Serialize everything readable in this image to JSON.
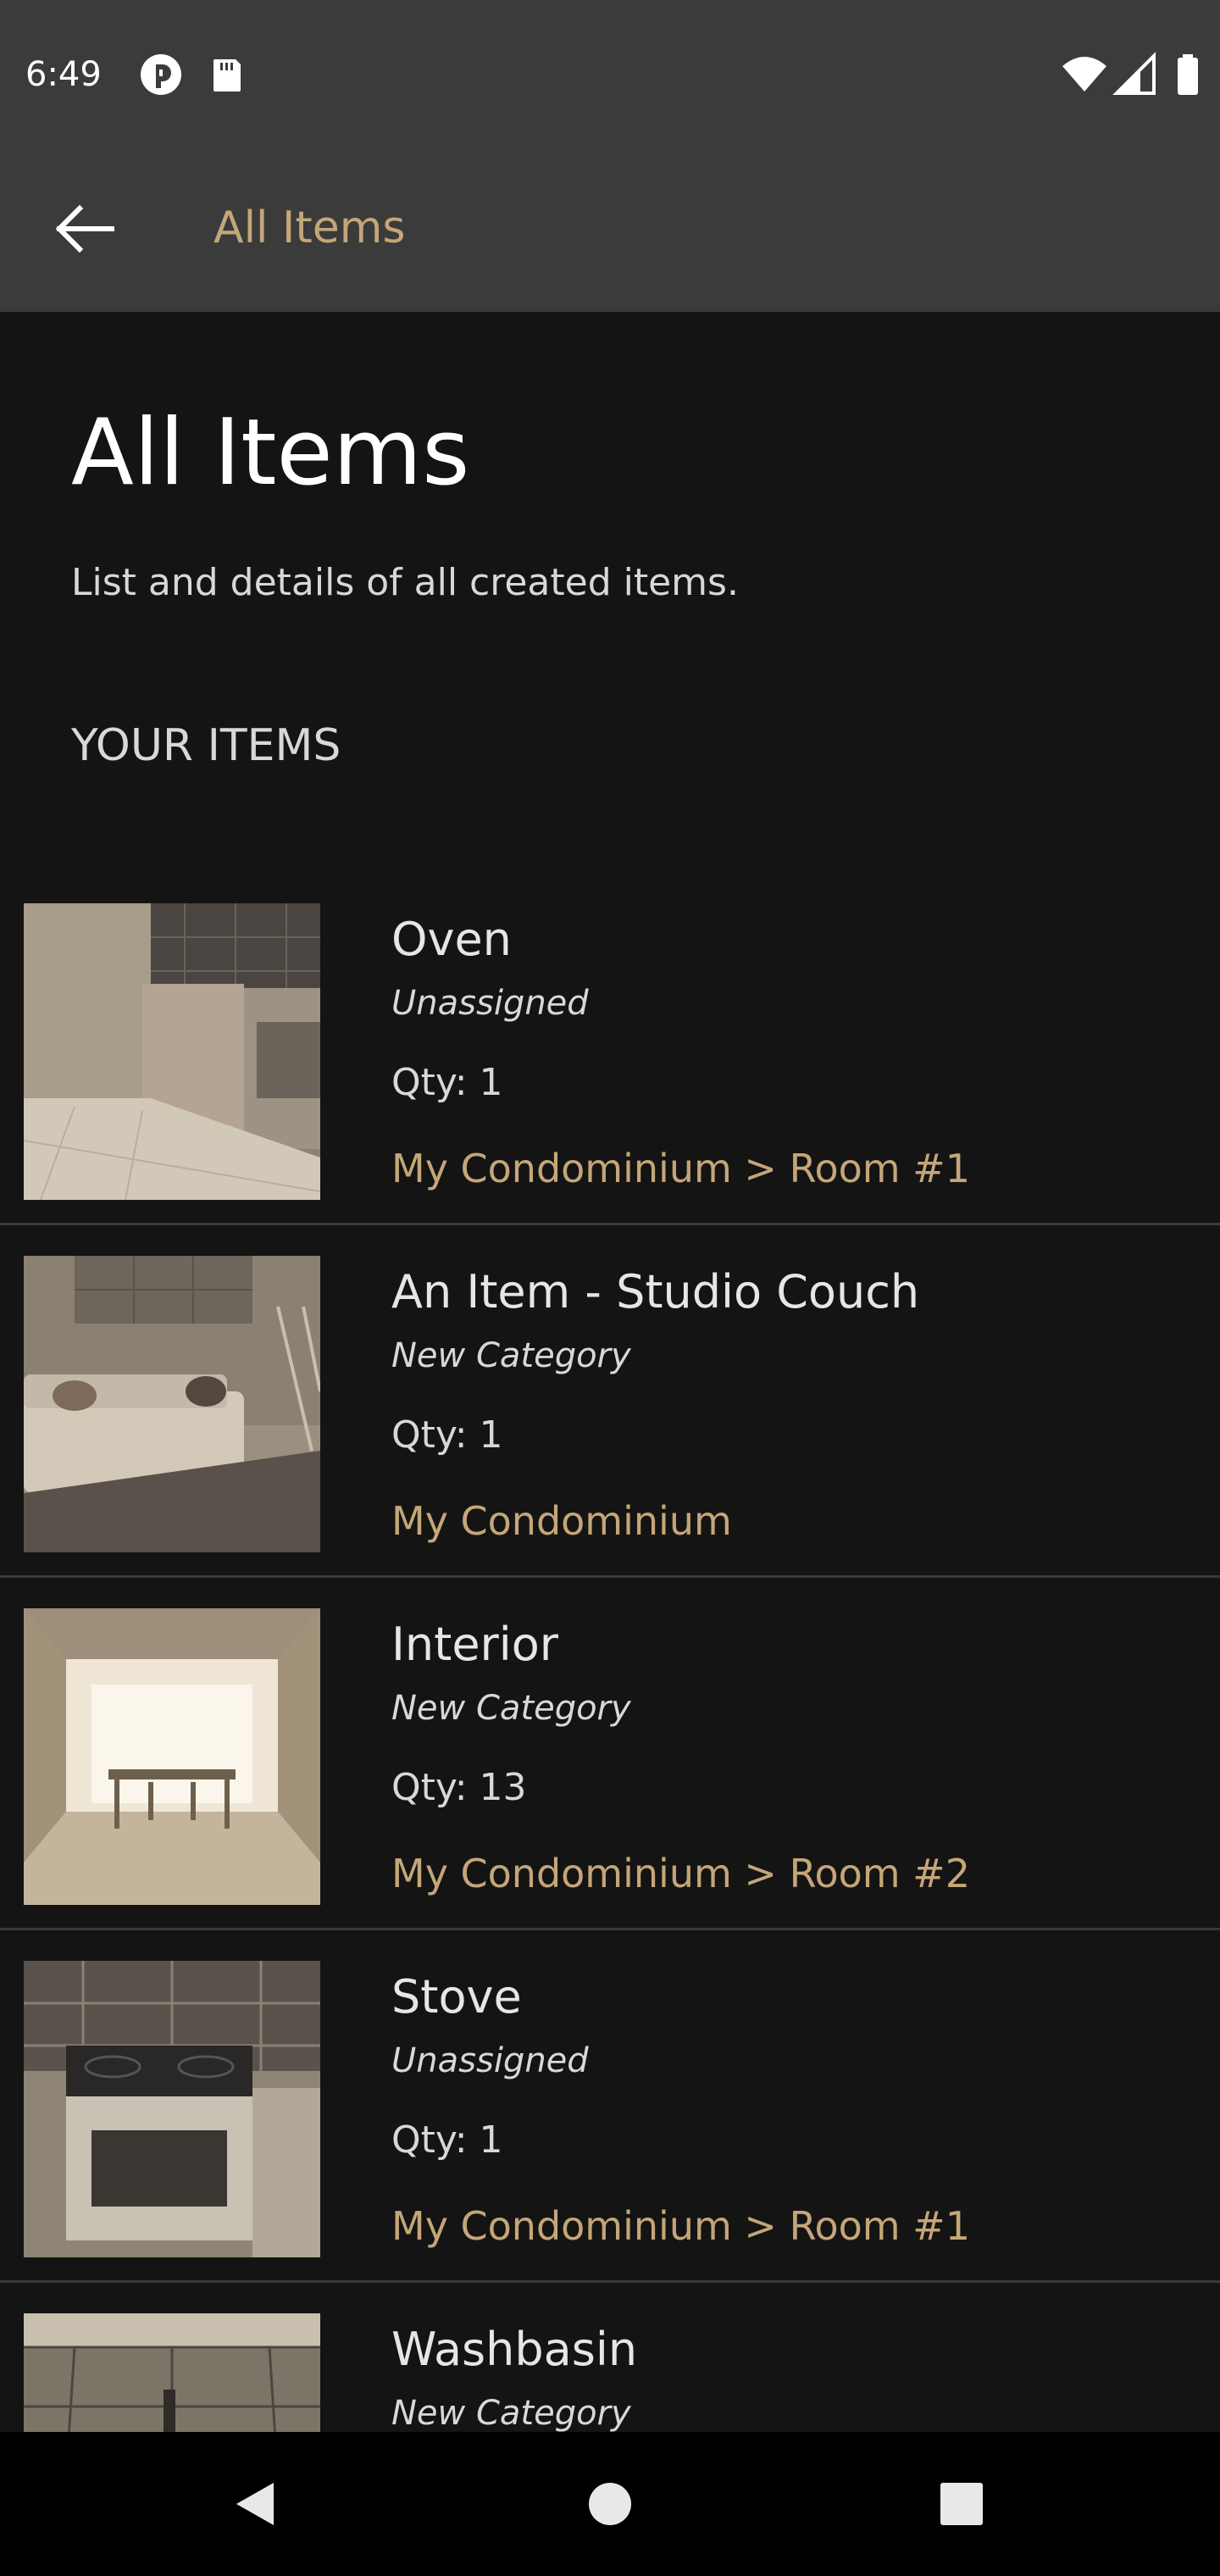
{
  "status_bar": {
    "time": "6:49",
    "left_icons": [
      "pocket-casts-icon",
      "sd-card-icon"
    ],
    "right_icons": [
      "wifi-icon",
      "signal-icon",
      "battery-icon"
    ]
  },
  "app_bar": {
    "title": "All Items",
    "back_icon": "back-arrow-icon"
  },
  "page": {
    "title": "All Items",
    "subtitle": "List and details of all created items.",
    "section_label": "YOUR ITEMS"
  },
  "items": [
    {
      "name": "Oven",
      "category": "Unassigned",
      "qty": "Qty: 1",
      "location": "My Condominium > Room #1",
      "thumbnail": "kitchen-oven-photo"
    },
    {
      "name": "An Item - Studio Couch",
      "category": "New Category",
      "qty": "Qty: 1",
      "location": "My Condominium",
      "thumbnail": "couch-photo"
    },
    {
      "name": "Interior",
      "category": "New Category",
      "qty": "Qty: 13",
      "location": "My Condominium > Room #2",
      "thumbnail": "dining-room-photo"
    },
    {
      "name": "Stove",
      "category": "Unassigned",
      "qty": "Qty: 1",
      "location": "My Condominium > Room #1",
      "thumbnail": "stove-photo"
    },
    {
      "name": "Washbasin",
      "category": "New Category",
      "qty": "",
      "location": "",
      "thumbnail": "washbasin-photo"
    }
  ],
  "nav_bar": {
    "buttons": [
      "nav-back-icon",
      "nav-home-icon",
      "nav-recents-icon"
    ]
  },
  "colors": {
    "accent": "#c5a678",
    "bar_background": "#3b3b3b",
    "page_background": "#141414",
    "divider": "#3a3a3a"
  }
}
